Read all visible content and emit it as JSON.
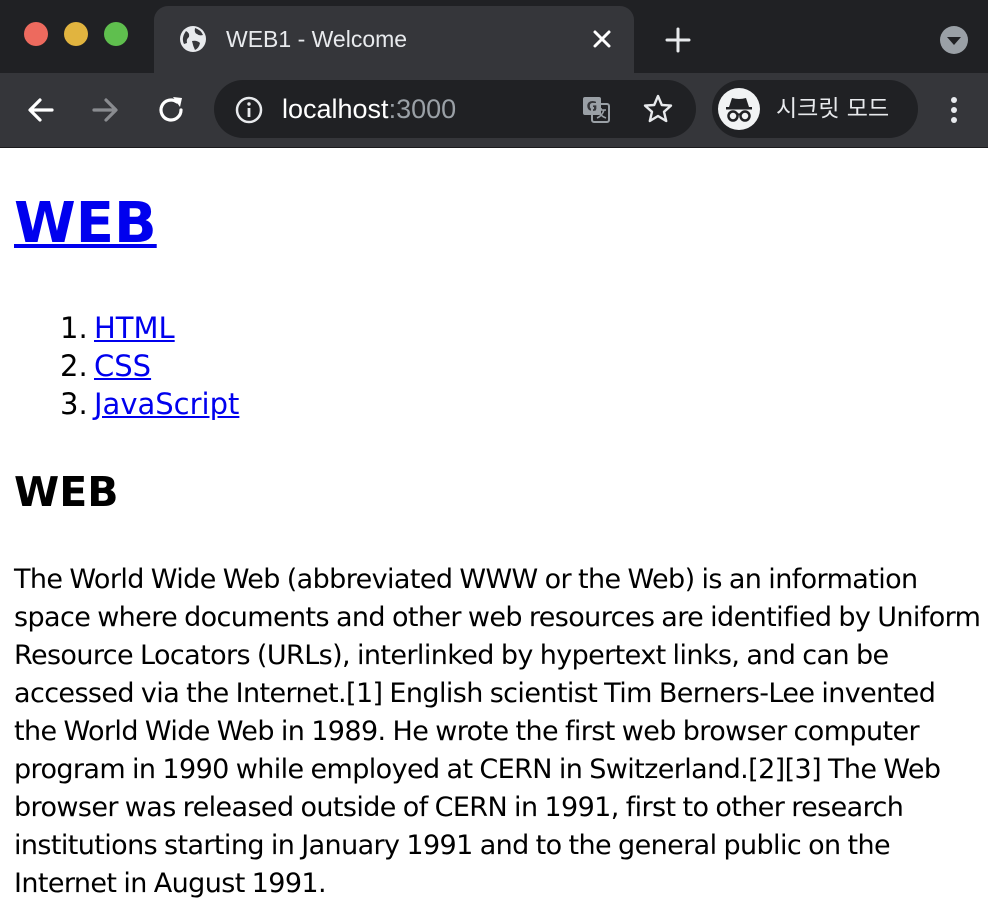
{
  "browser": {
    "tab_title": "WEB1 - Welcome",
    "url_host": "localhost",
    "url_port": ":3000",
    "profile_label": "시크릿 모드",
    "icons": [
      "globe-icon",
      "close-icon",
      "plus-icon",
      "tab-search-icon",
      "back-arrow-icon",
      "forward-arrow-icon",
      "reload-icon",
      "info-icon",
      "translate-icon",
      "star-icon",
      "incognito-icon",
      "kebab-menu-icon"
    ],
    "colors": {
      "frame": "#202124",
      "toolbar": "#35363a",
      "close": "#ed6a5e",
      "minimize": "#e1b43f",
      "maximize": "#5fbf4e"
    }
  },
  "page": {
    "site_title": "WEB",
    "nav": [
      {
        "number": "1.",
        "label": "HTML"
      },
      {
        "number": "2.",
        "label": "CSS"
      },
      {
        "number": "3.",
        "label": "JavaScript"
      }
    ],
    "heading": "WEB",
    "body": "The World Wide Web (abbreviated WWW or the Web) is an information space where documents and other web resources are identified by Uniform Resource Locators (URLs), interlinked by hypertext links, and can be accessed via the Internet.[1] English scientist Tim Berners-Lee invented the World Wide Web in 1989. He wrote the first web browser computer program in 1990 while employed at CERN in Switzerland.[2][3] The Web browser was released outside of CERN in 1991, first to other research institutions starting in January 1991 and to the general public on the Internet in August 1991.",
    "link_color": "#0000ee"
  }
}
